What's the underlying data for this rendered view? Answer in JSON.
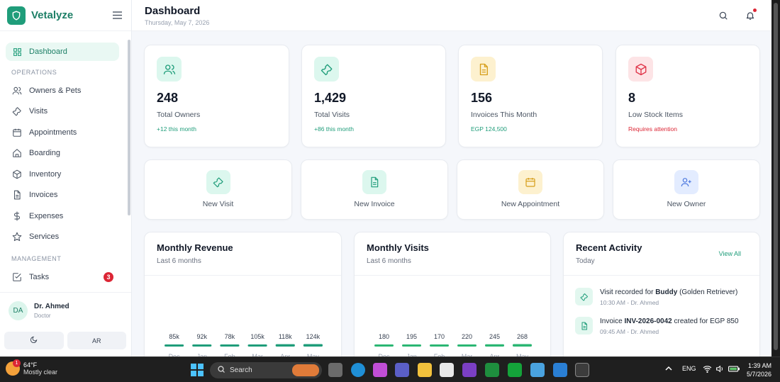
{
  "brand": {
    "name": "Vetalyze"
  },
  "header": {
    "title": "Dashboard",
    "date": "Thursday, May 7, 2026"
  },
  "sidebar": {
    "items": [
      {
        "label": "Dashboard",
        "icon": "grid-icon"
      },
      {
        "label": "Owners & Pets",
        "icon": "users-icon"
      },
      {
        "label": "Visits",
        "icon": "wrench-icon"
      },
      {
        "label": "Appointments",
        "icon": "calendar-icon"
      },
      {
        "label": "Boarding",
        "icon": "home-icon"
      },
      {
        "label": "Inventory",
        "icon": "box-icon"
      },
      {
        "label": "Invoices",
        "icon": "file-icon"
      },
      {
        "label": "Expenses",
        "icon": "dollar-icon"
      },
      {
        "label": "Services",
        "icon": "star-icon"
      },
      {
        "label": "Tasks",
        "icon": "check-square-icon",
        "badge": "3"
      }
    ],
    "sections": {
      "operations": "OPERATIONS",
      "management": "MANAGEMENT"
    },
    "user": {
      "initials": "DA",
      "name": "Dr. Ahmed",
      "role": "Doctor"
    },
    "lang_button": "AR"
  },
  "stats": [
    {
      "value": "248",
      "label": "Total Owners",
      "sub": "+12 this month",
      "sub_color": "#1f9d7a",
      "icon": "users-icon",
      "bg": "#dcf7ee",
      "fg": "#1f9d7a"
    },
    {
      "value": "1,429",
      "label": "Total Visits",
      "sub": "+86 this month",
      "sub_color": "#1f9d7a",
      "icon": "wrench-icon",
      "bg": "#dcf7ee",
      "fg": "#1f9d7a"
    },
    {
      "value": "156",
      "label": "Invoices This Month",
      "sub": "EGP 124,500",
      "sub_color": "#1f9d7a",
      "icon": "file-icon",
      "bg": "#fdf1cf",
      "fg": "#d69e1a"
    },
    {
      "value": "8",
      "label": "Low Stock Items",
      "sub": "Requires attention",
      "sub_color": "#dc2635",
      "icon": "box-icon",
      "bg": "#fde4e6",
      "fg": "#e0364a"
    }
  ],
  "quick_actions": [
    {
      "label": "New Visit",
      "icon": "wrench-icon",
      "bg": "#dcf7ee",
      "fg": "#1f9d7a"
    },
    {
      "label": "New Invoice",
      "icon": "file-icon",
      "bg": "#dcf7ee",
      "fg": "#1f9d7a"
    },
    {
      "label": "New Appointment",
      "icon": "calendar-icon",
      "bg": "#fdf1cf",
      "fg": "#d69e1a"
    },
    {
      "label": "New Owner",
      "icon": "user-plus-icon",
      "bg": "#e3ecff",
      "fg": "#4f7ae0"
    }
  ],
  "revenue": {
    "title": "Monthly Revenue",
    "subtitle": "Last 6 months"
  },
  "visits": {
    "title": "Monthly Visits",
    "subtitle": "Last 6 months"
  },
  "chart_data": [
    {
      "type": "bar",
      "title": "Monthly Revenue",
      "subtitle": "Last 6 months",
      "categories": [
        "Dec",
        "Jan",
        "Feb",
        "Mar",
        "Apr",
        "May"
      ],
      "values": [
        85000,
        92000,
        78000,
        105000,
        118000,
        124000
      ],
      "value_labels": [
        "85k",
        "92k",
        "78k",
        "105k",
        "118k",
        "124k"
      ],
      "color": "#1f9d7a"
    },
    {
      "type": "bar",
      "title": "Monthly Visits",
      "subtitle": "Last 6 months",
      "categories": [
        "Dec",
        "Jan",
        "Feb",
        "Mar",
        "Apr",
        "May"
      ],
      "values": [
        180,
        195,
        170,
        220,
        245,
        268
      ],
      "value_labels": [
        "180",
        "195",
        "170",
        "220",
        "245",
        "268"
      ],
      "color": "#2bb673"
    }
  ],
  "activity": {
    "title": "Recent Activity",
    "subtitle": "Today",
    "view_all": "View All",
    "items": [
      {
        "prefix": "Visit recorded for ",
        "bold": "Buddy",
        "suffix": " (Golden Retriever)",
        "time": "10:30 AM - Dr. Ahmed",
        "icon": "wrench-icon"
      },
      {
        "prefix": "Invoice ",
        "bold": "INV-2026-0042",
        "suffix": " created for EGP 850",
        "time": "09:45 AM - Dr. Ahmed",
        "icon": "file-icon"
      }
    ]
  },
  "taskbar": {
    "weather_temp": "64°F",
    "weather_desc": "Mostly clear",
    "weather_badge": "1",
    "search": "Search",
    "lang": "ENG",
    "time": "1:39 AM",
    "date": "5/7/2026"
  }
}
